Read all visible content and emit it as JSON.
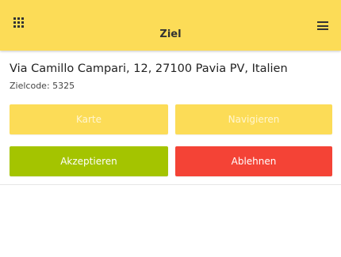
{
  "header": {
    "title": "Ziel",
    "apps_icon": "grid-icon",
    "menu_icon": "hamburger-menu-icon",
    "background": "#fcdc57"
  },
  "destination": {
    "address": "Via Camillo Campari, 12, 27100 Pavia PV, Italien",
    "code_label": "Zielcode: 5325"
  },
  "actions": {
    "map_label": "Karte",
    "navigate_label": "Navigieren",
    "accept_label": "Akzeptieren",
    "decline_label": "Ablehnen"
  },
  "colors": {
    "accent_yellow": "#fcdc57",
    "accept_green": "#a4c400",
    "decline_red": "#f44336"
  }
}
